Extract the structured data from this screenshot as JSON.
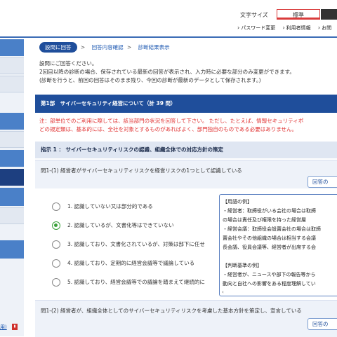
{
  "header": {
    "font_size_label": "文字サイズ",
    "font_size_standard": "標準",
    "font_size_large": "",
    "links": [
      "パスワード変更",
      "利用者情報",
      "お問"
    ]
  },
  "sidebar": {
    "link_text": "用)"
  },
  "breadcrumb": {
    "current": "設問に回答",
    "items": [
      "回答内容確認",
      "診断結果表示"
    ],
    "separator": ">"
  },
  "intro": [
    "設問にご回答ください。",
    "2回目以降の診断の場合、保存されている最新の回答が表示され、入力時に必要な部分のみ変更ができます。",
    "(診断を行うと、前回の回答はそのまま残り、今回の診断が最新のデータとして保存されます。)"
  ],
  "section": {
    "title": "第1部　サイバーセキュリティ経営について（計 39 問）"
  },
  "note": [
    "注：部単位でのご利用に際しては、該当部門の状況を回答して下さい。 ただし、たとえば、情報セキュリティポ",
    "どの規定類は、基本的には、全社を対象とするものがあればよく、部門独自のものである必要はありません。"
  ],
  "indicator": {
    "title": "指示 1 ： サイバーセキュリティリスクの認識、組織全体での対応方針の策定"
  },
  "questions": [
    {
      "text": "問1-(1) 経営者がサイバーセキュリティリスクを経営リスクの1つとして認識している",
      "button": "回答の"
    },
    {
      "text": "問1-(2) 経営者が、組織全体としてのサイバーセキュリティリスクを考慮した基本方針を策定し、宣言している",
      "button": "回答の"
    }
  ],
  "options": [
    {
      "label": "1. 認識していない又は部分的である",
      "checked": false
    },
    {
      "label": "2. 認識しているが、文書化等はできていない",
      "checked": true
    },
    {
      "label": "3. 認識しており、文書化されているが、対策は部下に任せ",
      "checked": false
    },
    {
      "label": "4. 認識しており、定期的に経営会議等で議論している",
      "checked": false
    },
    {
      "label": "5. 認識しており、経営会議等での議論を踏まえて継続的に",
      "checked": false
    }
  ],
  "glossary": {
    "lines": [
      "【用語の例】",
      "・経営者：取締役がいる会社の場合は取締",
      "の場合は責任及び権限を持った経営層",
      "・経営会議：取締役会設置会社の場合は取締",
      "置会社やその他組織の場合は相当する会議",
      "長会議、役員会議等、経営者が出席する会",
      "",
      "【判断基準の例】",
      "・経営者が、ニュースや部下の報告等から",
      "動向と自社への影響をある程度理解してい"
    ],
    "scroll_left": "‹"
  },
  "colors": {
    "accent": "#1f4e9b",
    "note_red": "#e03030",
    "radio_checked": "#3aa03a"
  }
}
